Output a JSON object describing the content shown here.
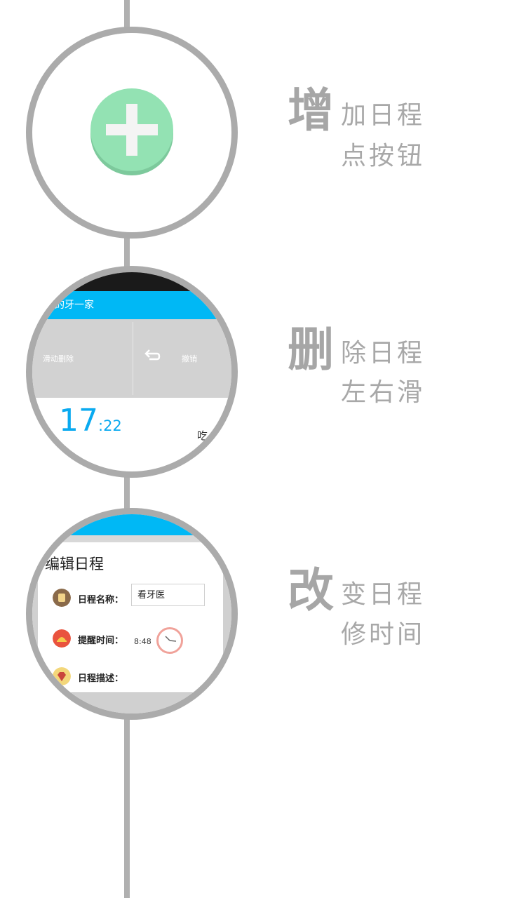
{
  "sections": [
    {
      "caption_big": "增",
      "caption_rest": "加日程",
      "caption_sub": "点按钮"
    },
    {
      "caption_big": "删",
      "caption_rest": "除日程",
      "caption_sub": "左右滑",
      "app_title": "我的牙一家",
      "swipe_delete_text": "滑动删除",
      "undo_text": "撤销",
      "time_hour": "17",
      "time_minute": ":22",
      "cut_text": "吃"
    },
    {
      "caption_big": "改",
      "caption_rest": "变日程",
      "caption_sub": "修时间",
      "dialog_title": "编辑日程",
      "name_label": "日程名称：",
      "name_value": "看牙医",
      "reminder_label": "提醒时间：",
      "reminder_value": "8:48",
      "desc_label": "日程描述："
    }
  ],
  "colors": {
    "accent": "#00b8f5",
    "add_button": "#93e2b3",
    "timeline": "#b0b0b0"
  }
}
